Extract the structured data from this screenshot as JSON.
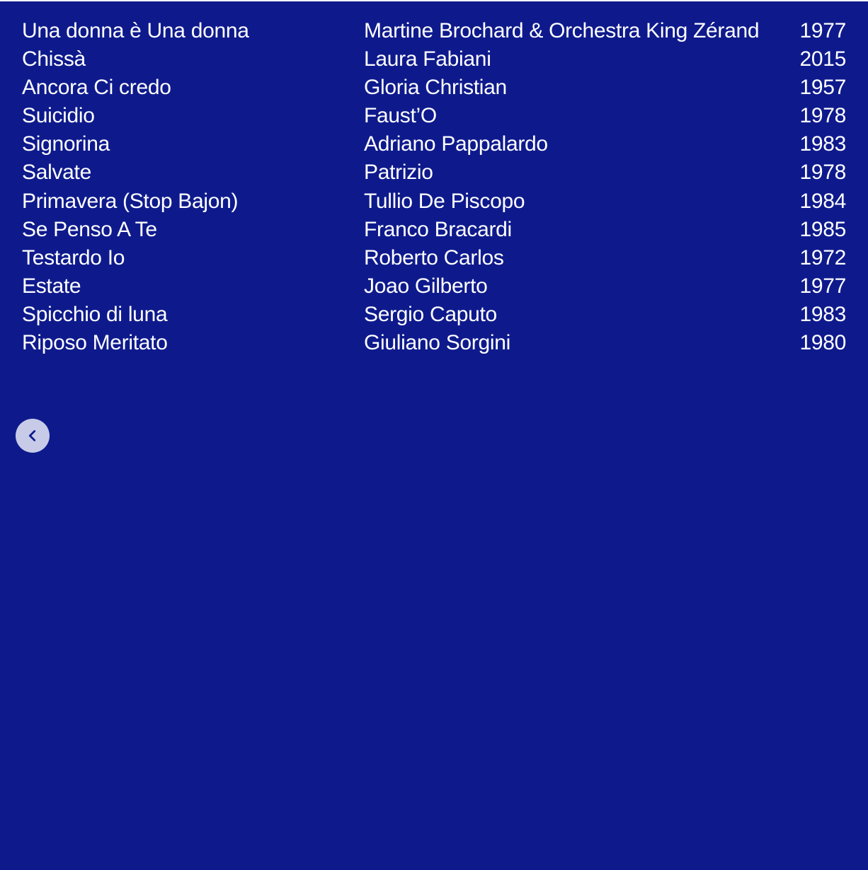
{
  "tracklist": [
    {
      "title": "Una donna è Una donna",
      "artist": "Martine Brochard & Orchestra King Zérand",
      "year": "1977"
    },
    {
      "title": "Chissà",
      "artist": "Laura Fabiani",
      "year": "2015"
    },
    {
      "title": "Ancora Ci credo",
      "artist": "Gloria Christian",
      "year": "1957"
    },
    {
      "title": "Suicidio",
      "artist": "Faust’O",
      "year": "1978"
    },
    {
      "title": "Signorina",
      "artist": "Adriano Pappalardo",
      "year": "1983"
    },
    {
      "title": "Salvate",
      "artist": "Patrizio",
      "year": "1978"
    },
    {
      "title": "Primavera (Stop Bajon)",
      "artist": "Tullio De Piscopo",
      "year": "1984"
    },
    {
      "title": "Se Penso A Te",
      "artist": "Franco Bracardi",
      "year": "1985"
    },
    {
      "title": "Testardo Io",
      "artist": "Roberto Carlos",
      "year": "1972"
    },
    {
      "title": "Estate",
      "artist": "Joao Gilberto",
      "year": "1977"
    },
    {
      "title": "Spicchio di luna",
      "artist": "Sergio Caputo",
      "year": "1983"
    },
    {
      "title": "Riposo Meritato",
      "artist": "Giuliano Sorgini",
      "year": "1980"
    }
  ],
  "navigation": {
    "back_icon": "chevron-left-icon"
  },
  "colors": {
    "background": "#0e1a8c",
    "text": "#ffffff",
    "button_bg": "#e1e4f5",
    "button_icon": "#0e1a8c"
  }
}
